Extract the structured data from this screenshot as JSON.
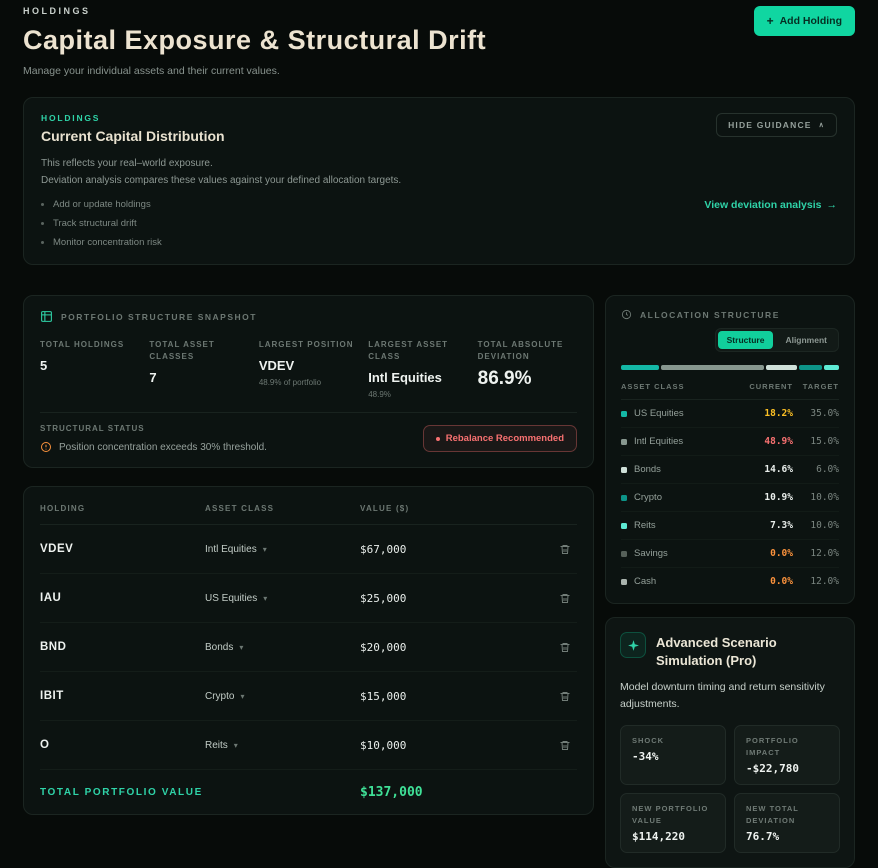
{
  "colors": {
    "accent": "#10d6a1",
    "danger": "#f87171",
    "warning": "#fb923c",
    "success": "#3fe097"
  },
  "icons": {
    "plus": "+",
    "caret_up": "∧",
    "arrow_right": "→",
    "chevron_down": "▾"
  },
  "page": {
    "eyebrow": "HOLDINGS",
    "title": "Capital Exposure & Structural Drift",
    "subtitle": "Manage your individual assets and their current values.",
    "add_button_label": "Add Holding"
  },
  "guidance": {
    "eyebrow": "HOLDINGS",
    "title": "Current Capital Distribution",
    "hide_label": "HIDE GUIDANCE",
    "lines": [
      "This reflects your real–world exposure.",
      "Deviation analysis compares these values against your defined allocation targets."
    ],
    "bullets": [
      "Add or update holdings",
      "Track structural drift",
      "Monitor concentration risk"
    ],
    "link_label": "View deviation analysis"
  },
  "snapshot": {
    "title": "PORTFOLIO STRUCTURE SNAPSHOT",
    "stats": [
      {
        "label": "TOTAL HOLDINGS",
        "value": "5"
      },
      {
        "label": "TOTAL ASSET CLASSES",
        "value": "7"
      },
      {
        "label": "LARGEST POSITION",
        "value": "VDEV",
        "sub": "48.9% of portfolio"
      },
      {
        "label": "LARGEST ASSET CLASS",
        "value": "Intl Equities",
        "sub": "48.9%"
      },
      {
        "label": "TOTAL ABSOLUTE DEVIATION",
        "value": "86.9%"
      }
    ],
    "status_label": "STRUCTURAL STATUS",
    "status_text": "Position concentration exceeds 30% threshold.",
    "badge_label": "Rebalance Recommended"
  },
  "holdings_table": {
    "headers": [
      "HOLDING",
      "ASSET CLASS",
      "VALUE ($)"
    ],
    "rows": [
      {
        "holding": "VDEV",
        "asset_class": "Intl Equities",
        "value": "$67,000"
      },
      {
        "holding": "IAU",
        "asset_class": "US Equities",
        "value": "$25,000"
      },
      {
        "holding": "BND",
        "asset_class": "Bonds",
        "value": "$20,000"
      },
      {
        "holding": "IBIT",
        "asset_class": "Crypto",
        "value": "$15,000"
      },
      {
        "holding": "O",
        "asset_class": "Reits",
        "value": "$10,000"
      }
    ],
    "total_label": "TOTAL PORTFOLIO VALUE",
    "total_value": "$137,000"
  },
  "allocation": {
    "title": "ALLOCATION STRUCTURE",
    "tabs": [
      {
        "label": "Structure",
        "active": true
      },
      {
        "label": "Alignment",
        "active": false
      }
    ],
    "headers": [
      "ASSET CLASS",
      "CURRENT",
      "TARGET"
    ],
    "bar": [
      {
        "pct": 18.2,
        "color": "#14b8a6"
      },
      {
        "pct": 48.9,
        "color": "#87978f"
      },
      {
        "pct": 14.6,
        "color": "#cfe0d9"
      },
      {
        "pct": 10.9,
        "color": "#0d9488"
      },
      {
        "pct": 7.3,
        "color": "#5eead4"
      }
    ],
    "rows": [
      {
        "name": "US Equities",
        "current": "18.2%",
        "target": "35.0%",
        "dot_color": "#14b8a6",
        "current_color": "#fbbf24"
      },
      {
        "name": "Intl Equities",
        "current": "48.9%",
        "target": "15.0%",
        "dot_color": "#87978f",
        "current_color": "#f87171"
      },
      {
        "name": "Bonds",
        "current": "14.6%",
        "target": "6.0%",
        "dot_color": "#cfe0d9",
        "current_color": "#e9eeeb"
      },
      {
        "name": "Crypto",
        "current": "10.9%",
        "target": "10.0%",
        "dot_color": "#0d9488",
        "current_color": "#e9eeeb"
      },
      {
        "name": "Reits",
        "current": "7.3%",
        "target": "10.0%",
        "dot_color": "#5eead4",
        "current_color": "#e9eeeb"
      },
      {
        "name": "Savings",
        "current": "0.0%",
        "target": "12.0%",
        "dot_color": "#566059",
        "current_color": "#fb923c"
      },
      {
        "name": "Cash",
        "current": "0.0%",
        "target": "12.0%",
        "dot_color": "#aab4ae",
        "current_color": "#fb923c"
      }
    ]
  },
  "scenario": {
    "title": "Advanced Scenario Simulation (Pro)",
    "description": "Model downturn timing and return sensitivity adjustments.",
    "stats": [
      {
        "label": "SHOCK",
        "value": "-34%"
      },
      {
        "label": "PORTFOLIO IMPACT",
        "value": "-$22,780"
      },
      {
        "label": "NEW PORTFOLIO VALUE",
        "value": "$114,220"
      },
      {
        "label": "NEW TOTAL DEVIATION",
        "value": "76.7%"
      }
    ]
  }
}
